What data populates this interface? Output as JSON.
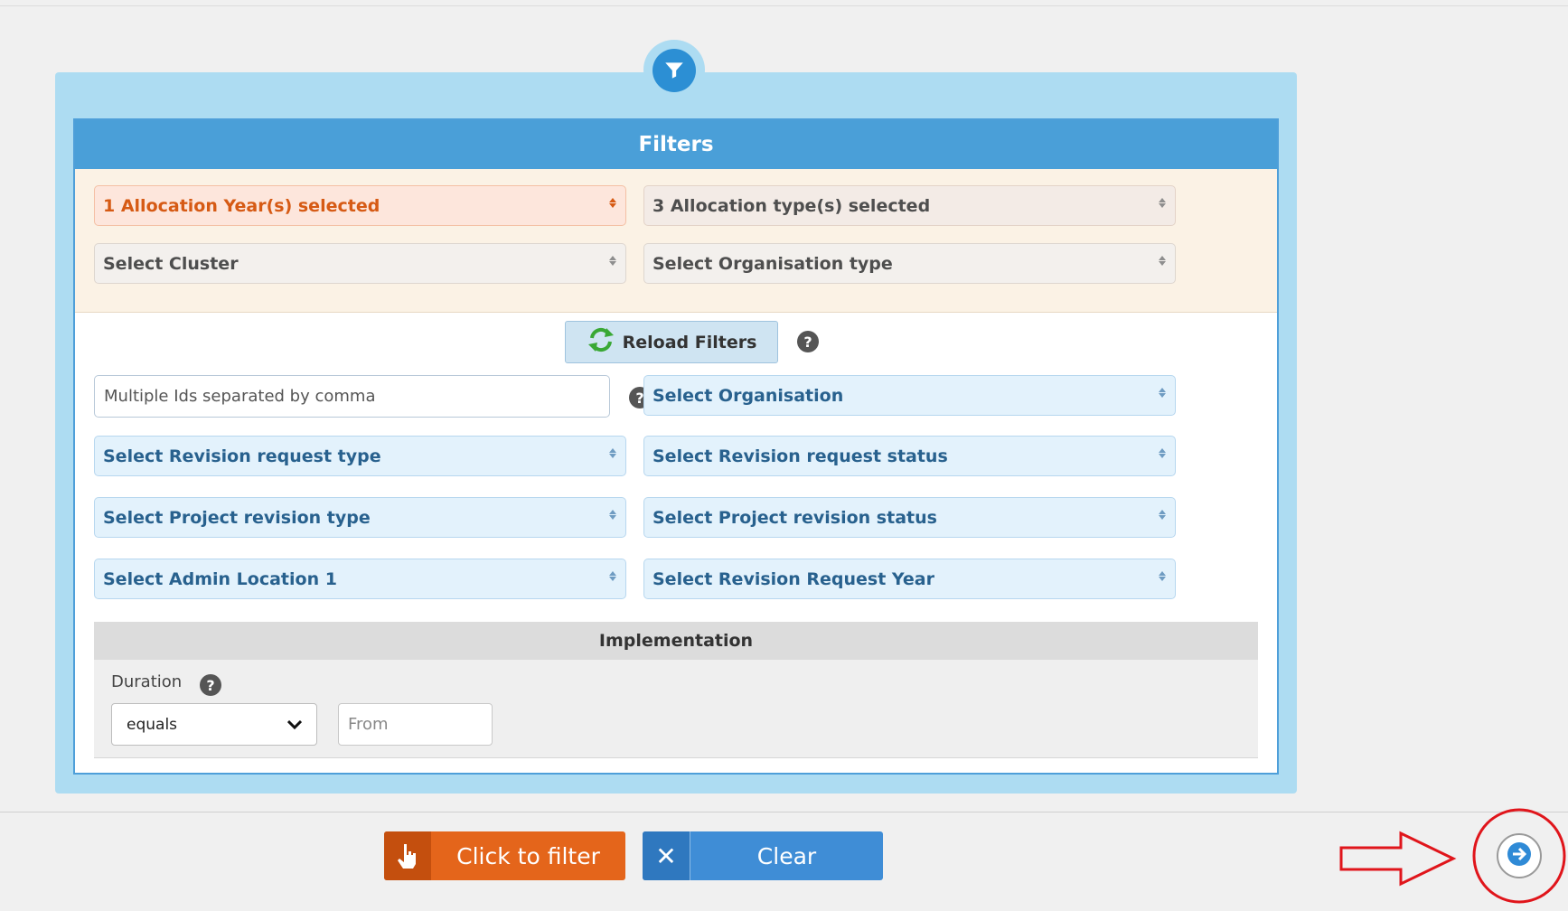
{
  "filters": {
    "title": "Filters",
    "allocation_year": "1 Allocation Year(s) selected",
    "allocation_type": "3 Allocation type(s) selected",
    "cluster": "Select Cluster",
    "organisation_type": "Select Organisation type",
    "reload_label": "Reload Filters",
    "ids_placeholder": "Multiple Ids separated by comma",
    "organisation": "Select Organisation",
    "revision_request_type": "Select Revision request type",
    "revision_request_status": "Select Revision request status",
    "project_revision_type": "Select Project revision type",
    "project_revision_status": "Select Project revision status",
    "admin_location": "Select Admin Location 1",
    "revision_request_year": "Select Revision Request Year"
  },
  "implementation": {
    "title": "Implementation",
    "duration_label": "Duration",
    "operator_value": "equals",
    "from_placeholder": "From"
  },
  "actions": {
    "filter_label": "Click to filter",
    "clear_label": "Clear"
  },
  "icons": {
    "filter": "funnel-icon",
    "reload": "refresh-icon",
    "help": "question-icon",
    "hand": "hand-pointer-icon",
    "clear": "x-icon",
    "next": "arrow-right-circle-icon"
  },
  "colors": {
    "header_blue": "#4a9fd8",
    "accent_orange": "#e4651b",
    "clear_blue": "#3f8dd6",
    "annotation_red": "#e0151b"
  }
}
